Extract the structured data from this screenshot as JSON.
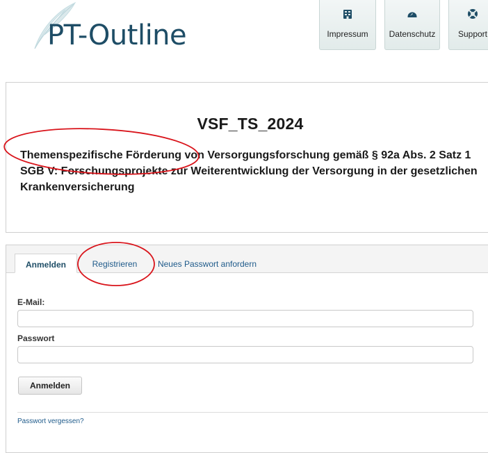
{
  "brand": {
    "logo_text": "PT-Outline"
  },
  "topnav": {
    "items": [
      {
        "label": "Impressum",
        "icon": "building-icon"
      },
      {
        "label": "Datenschutz",
        "icon": "dashboard-icon"
      },
      {
        "label": "Support",
        "icon": "lifebuoy-icon"
      }
    ]
  },
  "project": {
    "title": "VSF_TS_2024",
    "description_line1": "Themenspezifische Förderung von Versorgungsforschung gemäß § 92a Abs. 2 Satz 1",
    "description_line2": "SGB V: Forschungsprojekte zur Weiterentwicklung der Versorgung in der gesetzlichen",
    "description_line3": "Krankenversicherung"
  },
  "login": {
    "tabs": [
      {
        "label": "Anmelden",
        "active": true
      },
      {
        "label": "Registrieren",
        "active": false
      },
      {
        "label": "Neues Passwort anfordern",
        "active": false
      }
    ],
    "email_label": "E-Mail:",
    "email_value": "",
    "password_label": "Passwort",
    "password_value": "",
    "submit_label": "Anmelden",
    "forgot_label": "Passwort vergessen?"
  },
  "colors": {
    "brand_blue": "#1e4d66",
    "link_blue": "#1e5a8a",
    "annotation_red": "#d9141b"
  }
}
